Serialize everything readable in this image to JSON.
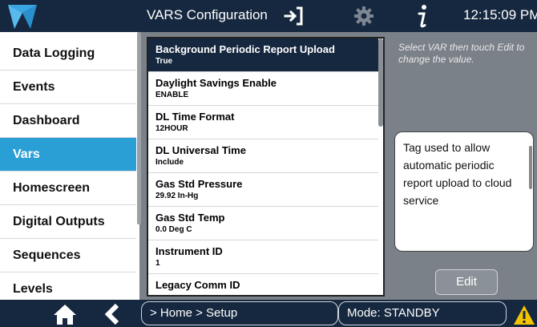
{
  "header": {
    "title": "VARS Configuration",
    "time": "12:15:09 PM",
    "icons": [
      "teledyne-logo-icon",
      "exit-icon",
      "gear-icon",
      "info-icon"
    ]
  },
  "sidebar": {
    "items": [
      {
        "label": "Data Logging",
        "active": false
      },
      {
        "label": "Events",
        "active": false
      },
      {
        "label": "Dashboard",
        "active": false
      },
      {
        "label": "Vars",
        "active": true
      },
      {
        "label": "Homescreen",
        "active": false
      },
      {
        "label": "Digital Outputs",
        "active": false
      },
      {
        "label": "Sequences",
        "active": false
      },
      {
        "label": "Levels",
        "active": false
      }
    ]
  },
  "vars": {
    "items": [
      {
        "name": "Background Periodic Report Upload",
        "value": "True",
        "selected": true
      },
      {
        "name": "Daylight Savings Enable",
        "value": "ENABLE",
        "selected": false
      },
      {
        "name": "DL Time Format",
        "value": "12HOUR",
        "selected": false
      },
      {
        "name": "DL Universal Time",
        "value": "Include",
        "selected": false
      },
      {
        "name": "Gas Std Pressure",
        "value": "29.92 In-Hg",
        "selected": false
      },
      {
        "name": "Gas Std Temp",
        "value": "0.0 Deg C",
        "selected": false
      },
      {
        "name": "Instrument ID",
        "value": "1",
        "selected": false
      },
      {
        "name": "Legacy Comm ID",
        "value": "",
        "selected": false
      }
    ]
  },
  "hint": {
    "text": "Select VAR then touch Edit to change the value."
  },
  "description": {
    "text": "Tag used to allow automatic periodic report upload to cloud service"
  },
  "edit_button": {
    "label": "Edit"
  },
  "footer": {
    "breadcrumb": "> Home > Setup",
    "mode": "Mode: STANDBY",
    "icons": [
      "home-icon",
      "back-icon",
      "warning-icon"
    ]
  },
  "colors": {
    "header_bg": "#16283f",
    "active_nav": "#2a9fd6",
    "selected_row": "#16283f",
    "background": "#7b8189",
    "warning": "#f5c400"
  }
}
